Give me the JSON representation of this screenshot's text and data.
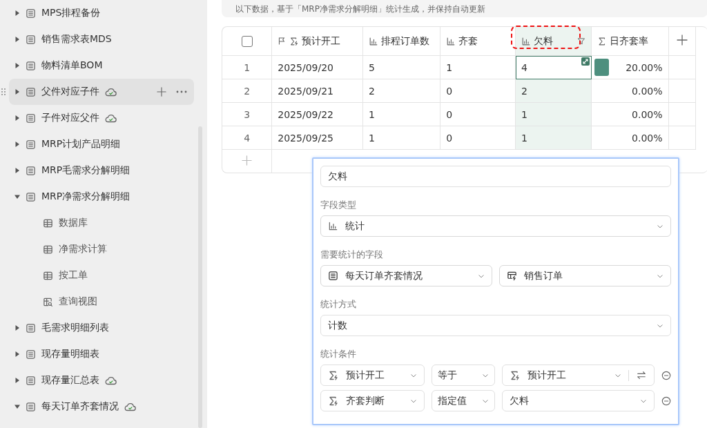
{
  "notice": "以下数据，基于「MRP净需求分解明细」统计生成，并保持自动更新",
  "sidebar": {
    "items": [
      {
        "label": "MPS排程备份",
        "kind": "table",
        "expanded": false,
        "synced": false,
        "selected": false
      },
      {
        "label": "销售需求表MDS",
        "kind": "table",
        "expanded": false,
        "synced": false,
        "selected": false
      },
      {
        "label": "物料清单BOM",
        "kind": "table",
        "expanded": false,
        "synced": false,
        "selected": false
      },
      {
        "label": "父件对应子件",
        "kind": "table",
        "expanded": false,
        "synced": true,
        "selected": true
      },
      {
        "label": "子件对应父件",
        "kind": "table",
        "expanded": false,
        "synced": true,
        "selected": false
      },
      {
        "label": "MRP计划产品明细",
        "kind": "table",
        "expanded": false,
        "synced": false,
        "selected": false
      },
      {
        "label": "MRP毛需求分解明细",
        "kind": "table",
        "expanded": false,
        "synced": false,
        "selected": false
      },
      {
        "label": "MRP净需求分解明细",
        "kind": "table",
        "expanded": true,
        "synced": false,
        "selected": false,
        "children": [
          {
            "label": "数据库",
            "kind": "grid",
            "synced": false,
            "selected": false
          },
          {
            "label": "净需求计算",
            "kind": "grid",
            "synced": false,
            "selected": false
          },
          {
            "label": "按工单",
            "kind": "grid",
            "synced": false,
            "selected": false
          },
          {
            "label": "查询视图",
            "kind": "query",
            "synced": false,
            "selected": false
          }
        ]
      },
      {
        "label": "毛需求明细列表",
        "kind": "table",
        "expanded": false,
        "synced": false,
        "selected": false
      },
      {
        "label": "现存量明细表",
        "kind": "table",
        "expanded": false,
        "synced": false,
        "selected": false
      },
      {
        "label": "现存量汇总表",
        "kind": "table",
        "expanded": false,
        "synced": true,
        "selected": false
      },
      {
        "label": "每天订单齐套情况",
        "kind": "table",
        "expanded": true,
        "synced": true,
        "selected": false
      }
    ]
  },
  "table": {
    "select_all_checked": false,
    "columns": [
      {
        "label": "预计开工",
        "kind": "formula",
        "selected": false,
        "primary": true
      },
      {
        "label": "排程订单数",
        "kind": "stat",
        "selected": false,
        "primary": false
      },
      {
        "label": "齐套",
        "kind": "stat",
        "selected": false,
        "primary": false
      },
      {
        "label": "欠料",
        "kind": "stat",
        "selected": true,
        "primary": false
      },
      {
        "label": "日齐套率",
        "kind": "sum",
        "selected": false,
        "primary": false
      }
    ],
    "rows": [
      {
        "index": "1",
        "cells": [
          "2025/09/20",
          "5",
          "1",
          "4"
        ],
        "rate": "20.00%",
        "level": 0.2,
        "focused": true
      },
      {
        "index": "2",
        "cells": [
          "2025/09/21",
          "2",
          "0",
          "2"
        ],
        "rate": "0.00%",
        "focused": false
      },
      {
        "index": "3",
        "cells": [
          "2025/09/22",
          "1",
          "0",
          "1"
        ],
        "rate": "0.00%",
        "focused": false
      },
      {
        "index": "4",
        "cells": [
          "2025/09/25",
          "1",
          "0",
          "1"
        ],
        "rate": "0.00%",
        "focused": false
      }
    ]
  },
  "field_editor": {
    "name": "欠料",
    "type_label": "字段类型",
    "type": {
      "kind": "stat",
      "value": "统计"
    },
    "source_label": "需要统计的字段",
    "source": [
      {
        "kind": "table",
        "value": "每天订单齐套情况"
      },
      {
        "kind": "link",
        "value": "销售订单"
      }
    ],
    "method_label": "统计方式",
    "method": {
      "value": "计数"
    },
    "conditions_label": "统计条件",
    "conditions": [
      {
        "field": "预计开工",
        "operator": "等于",
        "value": {
          "kind": "formula",
          "text": "预计开工"
        },
        "swap": true
      },
      {
        "field": "齐套判断",
        "operator": "指定值",
        "value": {
          "kind": "text",
          "text": "欠料"
        },
        "swap": false
      }
    ]
  }
}
